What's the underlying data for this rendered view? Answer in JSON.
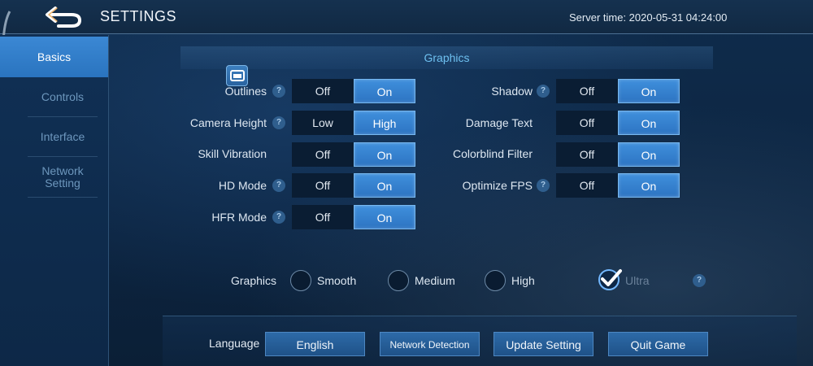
{
  "header": {
    "title": "SETTINGS",
    "server_time": "Server time: 2020-05-31 04:24:00"
  },
  "sidebar": {
    "items": [
      {
        "label": "Basics",
        "active": true
      },
      {
        "label": "Controls"
      },
      {
        "label": "Interface"
      },
      {
        "label": "Network Setting"
      }
    ]
  },
  "graphics_section": {
    "title": "Graphics"
  },
  "settings_left": [
    {
      "label": "Outlines",
      "help": "?",
      "off": "Off",
      "on": "On",
      "selected": "on"
    },
    {
      "label": "Camera Height",
      "help": "?",
      "off": "Low",
      "on": "High",
      "selected": "on"
    },
    {
      "label": "Skill Vibration",
      "off": "Off",
      "on": "On",
      "selected": "on"
    },
    {
      "label": "HD Mode",
      "help": "?",
      "off": "Off",
      "on": "On",
      "selected": "on"
    },
    {
      "label": "HFR Mode",
      "help": "?",
      "off": "Off",
      "on": "On",
      "selected": "on"
    }
  ],
  "settings_right": [
    {
      "label": "Shadow",
      "help": "?",
      "off": "Off",
      "on": "On",
      "selected": "on"
    },
    {
      "label": "Damage Text",
      "off": "Off",
      "on": "On",
      "selected": "on"
    },
    {
      "label": "Colorblind Filter",
      "off": "Off",
      "on": "On",
      "selected": "on"
    },
    {
      "label": "Optimize FPS",
      "help": "?",
      "off": "Off",
      "on": "On",
      "selected": "on"
    }
  ],
  "graphics_quality": {
    "label": "Graphics",
    "options": [
      "Smooth",
      "Medium",
      "High",
      "Ultra"
    ],
    "selected": "Ultra",
    "help": "?"
  },
  "footer": {
    "language_label": "Language",
    "language_value": "English",
    "network_detection": "Network Detection",
    "update_setting": "Update Setting",
    "quit_game": "Quit Game"
  },
  "colors": {
    "accent": "#3b88d4",
    "active_toggle": "#2d74c2",
    "section_title": "#6ec0f0"
  },
  "icons": [
    "back-arrow-icon",
    "edit-icon",
    "help-icon",
    "checkmark-icon"
  ]
}
